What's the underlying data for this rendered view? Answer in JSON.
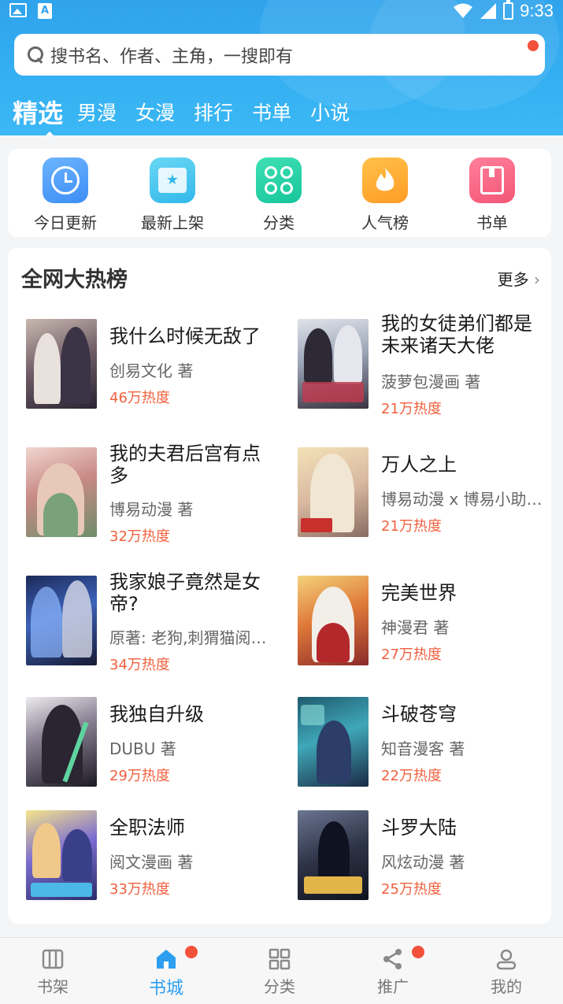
{
  "status_bar": {
    "time": "9:33"
  },
  "search": {
    "placeholder": "搜书名、作者、主角，一搜即有"
  },
  "tabs": [
    {
      "label": "精选",
      "active": true
    },
    {
      "label": "男漫"
    },
    {
      "label": "女漫"
    },
    {
      "label": "排行"
    },
    {
      "label": "书单"
    },
    {
      "label": "小说"
    }
  ],
  "quick_entries": [
    {
      "label": "今日更新",
      "icon": "clock-icon"
    },
    {
      "label": "最新上架",
      "icon": "new-shelf-icon"
    },
    {
      "label": "分类",
      "icon": "category-icon"
    },
    {
      "label": "人气榜",
      "icon": "flame-icon"
    },
    {
      "label": "书单",
      "icon": "booklist-icon"
    }
  ],
  "hot_list": {
    "title": "全网大热榜",
    "more": "更多",
    "books": [
      {
        "title": "我什么时候无敌了",
        "author": "创易文化 著",
        "heat": "46万热度"
      },
      {
        "title": "我的女徒弟们都是未来诸天大佬",
        "author": "菠萝包漫画 著",
        "heat": "21万热度"
      },
      {
        "title": "我的夫君后宫有点多",
        "author": "博易动漫 著",
        "heat": "32万热度"
      },
      {
        "title": "万人之上",
        "author": "博易动漫 x 博易小助…",
        "heat": "21万热度"
      },
      {
        "title": "我家娘子竟然是女帝?",
        "author": "原著: 老狗,刺猬猫阅…",
        "heat": "34万热度"
      },
      {
        "title": "完美世界",
        "author": "神漫君 著",
        "heat": "27万热度"
      },
      {
        "title": "我独自升级",
        "author": "DUBU 著",
        "heat": "29万热度"
      },
      {
        "title": "斗破苍穹",
        "author": "知音漫客 著",
        "heat": "22万热度"
      },
      {
        "title": "全职法师",
        "author": "阅文漫画 著",
        "heat": "33万热度"
      },
      {
        "title": "斗罗大陆",
        "author": "风炫动漫 著",
        "heat": "25万热度"
      }
    ]
  },
  "bottom_nav": [
    {
      "label": "书架"
    },
    {
      "label": "书城",
      "active": true,
      "badge": true
    },
    {
      "label": "分类"
    },
    {
      "label": "推广",
      "badge": true
    },
    {
      "label": "我的"
    }
  ],
  "colors": {
    "accent": "#2e9ff0",
    "heat": "#f1613f",
    "badge": "#f4513b"
  }
}
